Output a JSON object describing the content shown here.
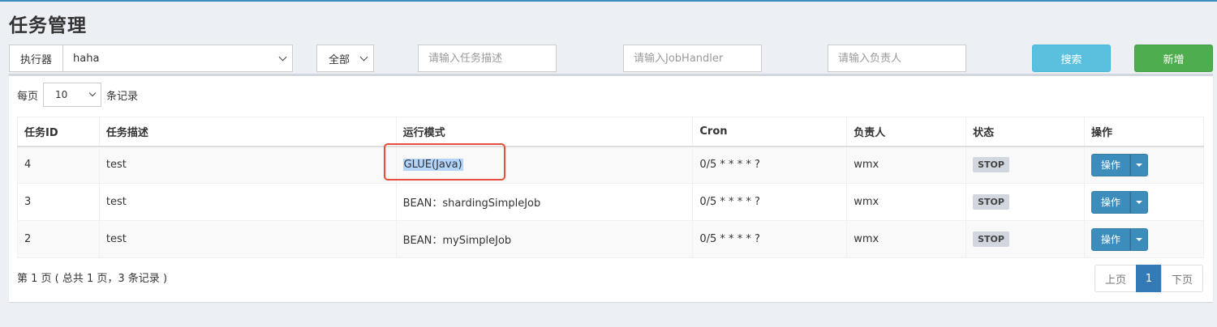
{
  "page": {
    "title": "任务管理"
  },
  "filters": {
    "executor_label": "执行器",
    "executor_value": "haha",
    "status_value": "全部",
    "desc_placeholder": "请输入任务描述",
    "handler_placeholder": "请输入JobHandler",
    "author_placeholder": "请输入负责人",
    "search_label": "搜索",
    "add_label": "新增"
  },
  "length": {
    "prefix": "每页",
    "value": "10",
    "suffix": "条记录"
  },
  "table": {
    "headers": [
      "任务ID",
      "任务描述",
      "运行模式",
      "Cron",
      "负责人",
      "状态",
      "操作"
    ],
    "rows": [
      {
        "id": "4",
        "desc": "test",
        "mode": "GLUE(Java)",
        "cron": "0/5 * * * * ?",
        "author": "wmx",
        "status": "STOP",
        "op": "操作"
      },
      {
        "id": "3",
        "desc": "test",
        "mode": "BEAN：shardingSimpleJob",
        "cron": "0/5 * * * * ?",
        "author": "wmx",
        "status": "STOP",
        "op": "操作"
      },
      {
        "id": "2",
        "desc": "test",
        "mode": "BEAN：mySimpleJob",
        "cron": "0/5 * * * * ?",
        "author": "wmx",
        "status": "STOP",
        "op": "操作"
      }
    ]
  },
  "info": "第 1 页 ( 总共 1 页，3 条记录 )",
  "pagination": {
    "prev": "上页",
    "current": "1",
    "next": "下页"
  },
  "colors": {
    "accent": "#3c8dbc",
    "search": "#5bc0de",
    "add": "#4cae4c",
    "highlight": "#e74c3c"
  }
}
